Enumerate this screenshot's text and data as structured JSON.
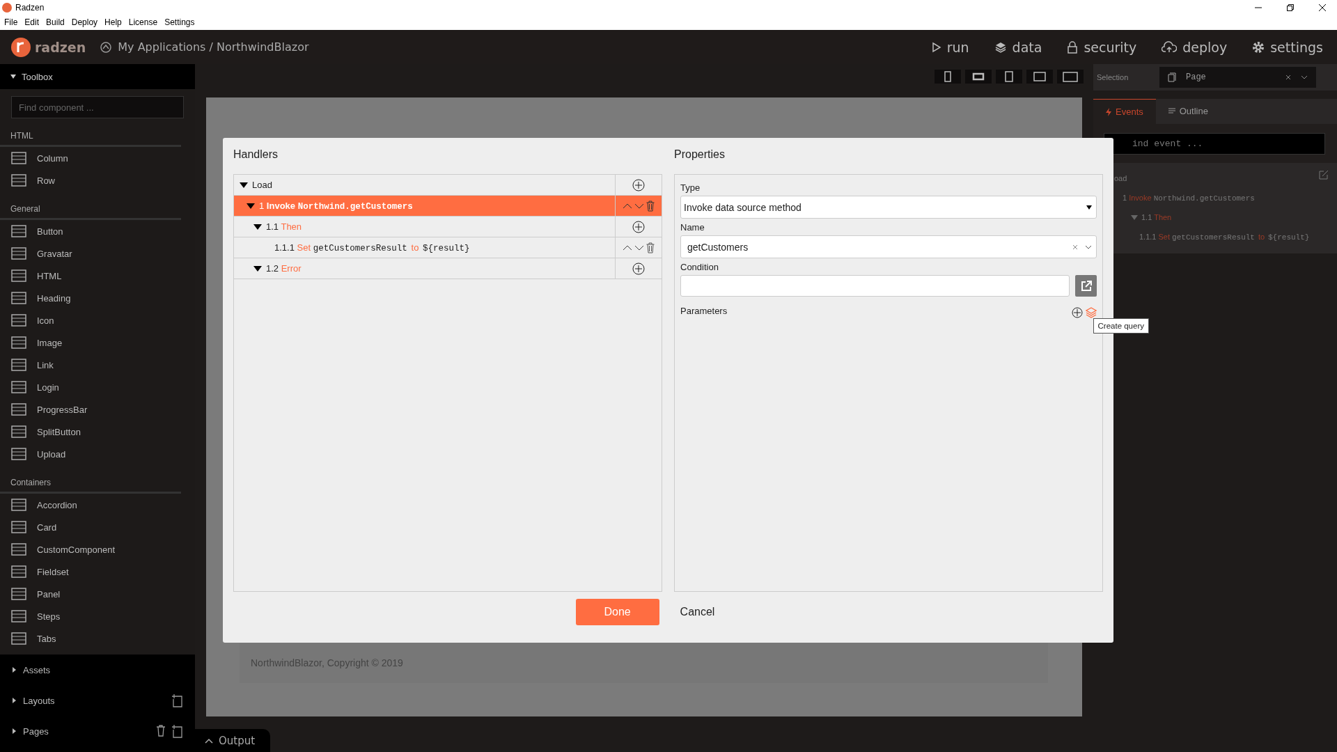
{
  "window": {
    "title": "Radzen"
  },
  "menu": [
    "File",
    "Edit",
    "Build",
    "Deploy",
    "Help",
    "License",
    "Settings"
  ],
  "header": {
    "logo": "radzen",
    "breadcrumb": "My Applications / NorthwindBlazor",
    "nav": [
      "run",
      "data",
      "security",
      "deploy",
      "settings"
    ]
  },
  "toolbox": {
    "title": "Toolbox",
    "expanded": true,
    "search": {
      "placeholder": "Find component ..."
    },
    "groups": [
      {
        "title": "HTML",
        "items": [
          "Column",
          "Row"
        ]
      },
      {
        "title": "General",
        "items": [
          "Button",
          "Gravatar",
          "HTML",
          "Heading",
          "Icon",
          "Image",
          "Link",
          "Login",
          "ProgressBar",
          "SplitButton",
          "Upload"
        ]
      },
      {
        "title": "Containers",
        "items": [
          "Accordion",
          "Card",
          "CustomComponent",
          "Fieldset",
          "Panel",
          "Steps",
          "Tabs"
        ]
      }
    ]
  },
  "sidebar_sections": [
    {
      "label": "Assets",
      "expanded": false,
      "kind": "plain"
    },
    {
      "label": "Layouts",
      "expanded": false,
      "kind": "new"
    },
    {
      "label": "Pages",
      "expanded": false,
      "kind": "newdelete"
    }
  ],
  "output_tab": {
    "label": "Output"
  },
  "canvas": {
    "footer": "NorthwindBlazor, Copyright © 2019"
  },
  "selection": {
    "label": "Selection",
    "value": "Page"
  },
  "right_tabs": [
    {
      "label": "Events",
      "selected": true
    },
    {
      "label": "Outline",
      "selected": false
    }
  ],
  "events": {
    "search": {
      "placeholder": "ind event ..."
    },
    "tree": [
      {
        "label": "oad",
        "children": [
          {
            "number": "1",
            "action": "Invoke",
            "target": "Northwind.getCustomers",
            "children": [
              {
                "number": "1.1",
                "action": "Then",
                "expanded": true,
                "children": [
                  {
                    "number": "1.1.1",
                    "action": "Set",
                    "target": "getCustomersResult",
                    "connector": "to",
                    "value": "${result}"
                  }
                ]
              }
            ]
          }
        ]
      }
    ]
  },
  "dialog": {
    "handlers": {
      "title": "Handlers",
      "tree": [
        {
          "label": "Load",
          "kind": "group",
          "expanded": true,
          "selected": false,
          "children": [
            {
              "number": "1",
              "action": "Invoke",
              "target": "Northwind.getCustomers",
              "kind": "action",
              "expanded": true,
              "selected": true,
              "children": [
                {
                  "number": "1.1",
                  "action": "Then",
                  "kind": "group",
                  "expanded": true,
                  "selected": false,
                  "children": [
                    {
                      "number": "1.1.1",
                      "action": "Set",
                      "target": "getCustomersResult",
                      "connector": "to",
                      "value": "${result}",
                      "kind": "action",
                      "selected": false
                    }
                  ]
                },
                {
                  "number": "1.2",
                  "action": "Error",
                  "kind": "group",
                  "expanded": true,
                  "selected": false
                }
              ]
            }
          ]
        }
      ]
    },
    "properties": {
      "title": "Properties",
      "type": {
        "label": "Type",
        "value": "Invoke data source method"
      },
      "name": {
        "label": "Name",
        "value": "getCustomers"
      },
      "condition": {
        "label": "Condition"
      },
      "parameters": {
        "label": "Parameters",
        "tooltip": "Create query"
      }
    },
    "buttons": {
      "done": "Done",
      "cancel": "Cancel"
    }
  }
}
